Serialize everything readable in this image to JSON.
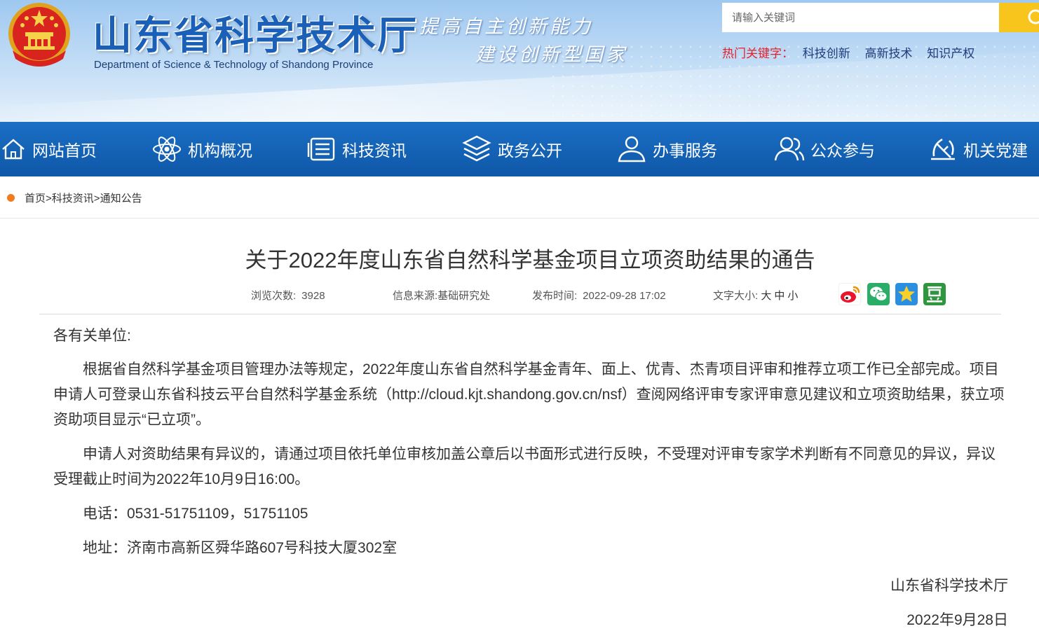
{
  "header": {
    "title": "山东省科学技术厅",
    "subtitle": "Department of Science & Technology of Shandong Province",
    "slogan_line1": "提高自主创新能力",
    "slogan_line2": "建设创新型国家",
    "search_placeholder": "请输入关键词",
    "hot_label": "热门关键字：",
    "hot_keywords": [
      "科技创新",
      "高新技术",
      "知识产权"
    ]
  },
  "nav": [
    {
      "label": "网站首页",
      "icon": "home-icon"
    },
    {
      "label": "机构概况",
      "icon": "atom-icon"
    },
    {
      "label": "科技资讯",
      "icon": "news-list-icon"
    },
    {
      "label": "政务公开",
      "icon": "layers-icon"
    },
    {
      "label": "办事服务",
      "icon": "user-service-icon"
    },
    {
      "label": "公众参与",
      "icon": "group-icon"
    },
    {
      "label": "机关党建",
      "icon": "party-emblem-icon"
    }
  ],
  "breadcrumb": {
    "items": [
      "首页",
      "科技资讯",
      "通知公告"
    ],
    "separator": ">"
  },
  "article": {
    "title": "关于2022年度山东省自然科学基金项目立项资助结果的通告",
    "views_label": "浏览次数:",
    "views": "3928",
    "source_label": "信息来源:",
    "source": "基础研究处",
    "date_label": "发布时间:",
    "date": "2022-09-28 17:02",
    "fontsize_label": "文字大小:",
    "fontsize_options": [
      "大",
      "中",
      "小"
    ],
    "share_icons": [
      "weibo-icon",
      "wechat-icon",
      "qzone-icon",
      "douban-icon"
    ],
    "greeting": "各有关单位:",
    "para1": "根据省自然科学基金项目管理办法等规定，2022年度山东省自然科学基金青年、面上、优青、杰青项目评审和推荐立项工作已全部完成。项目申请人可登录山东省科技云平台自然科学基金系统（http://cloud.kjt.shandong.gov.cn/nsf）查阅网络评审专家评审意见建议和立项资助结果，获立项资助项目显示“已立项”。",
    "para2": "申请人对资助结果有异议的，请通过项目依托单位审核加盖公章后以书面形式进行反映，不受理对评审专家学术判断有不同意见的异议，异议受理截止时间为2022年10月9日16:00。",
    "phone": "电话：0531-51751109，51751105",
    "address": "地址：济南市高新区舜华路607号科技大厦302室",
    "signature": "山东省科学技术厅",
    "sign_date": "2022年9月28日"
  },
  "colors": {
    "nav_bg": "#1461b5",
    "title_blue": "#1a5fb8",
    "hot_red": "#e6212a",
    "search_yellow": "#f8c51c",
    "crumb_dot": "#f07c1f"
  }
}
